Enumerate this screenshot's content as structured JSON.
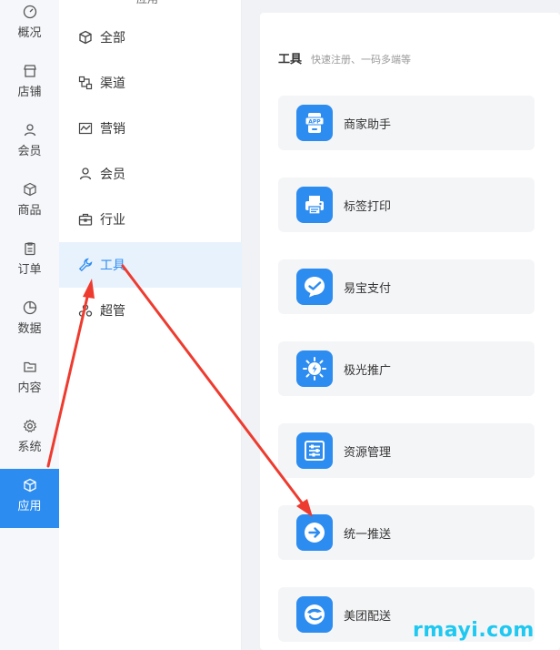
{
  "primary_nav": {
    "items": [
      {
        "label": "概况",
        "icon": "dashboard-icon"
      },
      {
        "label": "店铺",
        "icon": "store-icon"
      },
      {
        "label": "会员",
        "icon": "user-icon"
      },
      {
        "label": "商品",
        "icon": "box-icon"
      },
      {
        "label": "订单",
        "icon": "clipboard-icon"
      },
      {
        "label": "数据",
        "icon": "pie-icon"
      },
      {
        "label": "内容",
        "icon": "folder-icon"
      },
      {
        "label": "系统",
        "icon": "gear-icon"
      },
      {
        "label": "应用",
        "icon": "cube-icon",
        "active": true
      }
    ]
  },
  "secondary_nav": {
    "top_partial": "应用",
    "items": [
      {
        "label": "全部",
        "icon": "cube-icon"
      },
      {
        "label": "渠道",
        "icon": "channel-icon"
      },
      {
        "label": "营销",
        "icon": "chart-icon"
      },
      {
        "label": "会员",
        "icon": "user-icon"
      },
      {
        "label": "行业",
        "icon": "briefcase-icon"
      },
      {
        "label": "工具",
        "icon": "wrench-icon",
        "active": true
      },
      {
        "label": "超管",
        "icon": "shield-icon"
      }
    ]
  },
  "main": {
    "section_title": "工具",
    "section_subtitle": "快速注册、一码多端等",
    "cards": [
      {
        "label": "商家助手",
        "icon": "app-phone-icon"
      },
      {
        "label": "标签打印",
        "icon": "printer-icon"
      },
      {
        "label": "易宝支付",
        "icon": "pay-check-icon"
      },
      {
        "label": "极光推广",
        "icon": "sun-bolt-icon"
      },
      {
        "label": "资源管理",
        "icon": "sliders-icon"
      },
      {
        "label": "统一推送",
        "icon": "arrow-circle-icon"
      },
      {
        "label": "美团配送",
        "icon": "meituan-icon"
      }
    ]
  },
  "watermark": "rmayi.com",
  "colors": {
    "accent": "#2d8cf0",
    "annotation": "#ee3b2f",
    "watermark": "#1ec8f0"
  }
}
